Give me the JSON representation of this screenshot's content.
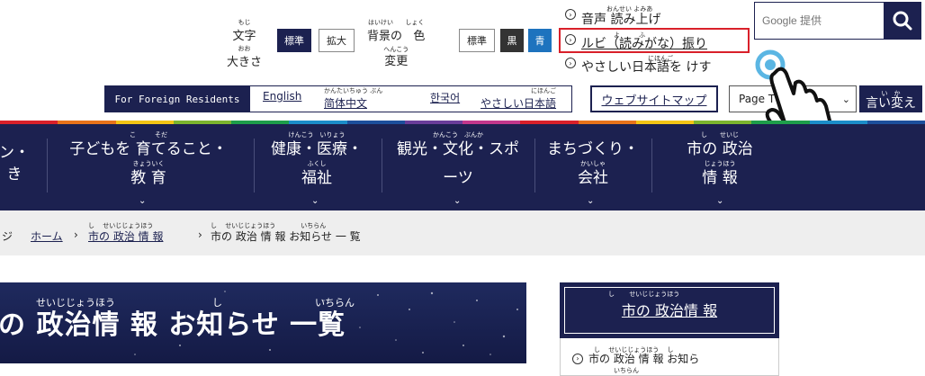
{
  "font_size": {
    "label_ruby_moji": "もじ",
    "label_moji": "文字",
    "label_ruby_oo": "おお",
    "label_ookisa": "大きさ",
    "standard_label": "標準",
    "enlarge_label": "拡大"
  },
  "bg_color": {
    "label_ruby_haikei": "はいけい",
    "label_haikei": "背景の",
    "label_ruby_shoku": "しょく",
    "label_iro": "色",
    "label_ruby_henkou": "へんこう",
    "label_henkou": "変更",
    "standard_label": "標準",
    "black_label": "黒",
    "blue_label": "青"
  },
  "accessibility_links": [
    {
      "label": "音声 読み上げ",
      "ruby": "おんせい よみあ"
    },
    {
      "label": "ルビ（読みがな）振り",
      "ruby": "よ　　　ふ"
    },
    {
      "label": "やさしい日本語を けす",
      "ruby": "にほんご"
    }
  ],
  "search": {
    "placeholder": "Google 提供",
    "button_icon": "search-icon"
  },
  "foreign": {
    "label": "For Foreign Residents",
    "languages": [
      {
        "label": "English",
        "ruby": ""
      },
      {
        "label": "简体中文",
        "ruby": "かんたいちゅう ぶん"
      },
      {
        "label": "한국어",
        "ruby": ""
      },
      {
        "label": "やさしい日本語",
        "ruby": "にほんご"
      }
    ]
  },
  "sitemap_label": "ウェブサイトマップ",
  "page_select_value": "Page T",
  "translate": {
    "label": "言い変え",
    "ruby": "い　か"
  },
  "stripe_colors": [
    "#d9202a",
    "#e8731a",
    "#f3c515",
    "#7cb52e",
    "#1e9e4a",
    "#1b8dc9",
    "#1c4f9c",
    "#6a3d9a",
    "#c2378b",
    "#d9202a",
    "#e8731a",
    "#f3c515",
    "#7cb52e",
    "#1e9e4a",
    "#1b8dc9",
    "#1c4f9c"
  ],
  "nav": {
    "items": [
      {
        "line1": "ン・",
        "line2": "き"
      },
      {
        "line1": "子どもを 育てること・",
        "line2": "教 育",
        "ruby1": "こ　　　そだ",
        "ruby2": "きょういく"
      },
      {
        "line1": "健康・医療・",
        "line2": "福祉",
        "ruby1": "けんこう　いりょう",
        "ruby2": "ふくし"
      },
      {
        "line1": "観光・文化・スポ",
        "line2": "ーツ",
        "ruby1": "かんこう　ぶんか"
      },
      {
        "line1": "まちづくり・",
        "line2": "会社",
        "ruby2": "かいしゃ"
      },
      {
        "line1": "市の 政治",
        "line2": "情 報",
        "ruby1": "し　　せいじ",
        "ruby2": "じょうほう"
      }
    ]
  },
  "breadcrumb": {
    "partial": "ジ",
    "home": "ホーム",
    "politics_info": "市の 政治 情 報",
    "politics_info_ruby": "し　 せいじじょうほう",
    "current": "市の 政治 情 報 お知らせ 一 覧",
    "current_ruby": "し　 せいじじょうほう　　　　いちらん"
  },
  "page_title": {
    "text": "の 政治情 報 お知らせ 一覧",
    "ruby_seijijouhou": "せいじじょうほう",
    "ruby_shi": "し",
    "ruby_ichiran": "いちらん"
  },
  "side": {
    "title": "市の 政治情 報",
    "title_ruby": "し　　 せいじじょうほう",
    "link": "市の 政治 情 報 お知ら",
    "link_ruby": "し　 せいじじょうほう　 し",
    "link_ruby2": "いちらん"
  },
  "colors": {
    "navy": "#1c2150",
    "highlight_red": "#d9202a",
    "blue": "#1e73be"
  }
}
